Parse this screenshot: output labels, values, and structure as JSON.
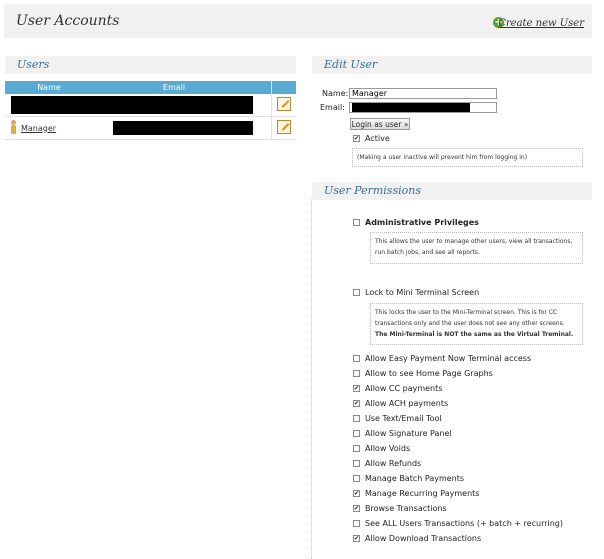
{
  "header": {
    "title": "User Accounts",
    "create_label": "Create new User"
  },
  "users": {
    "panel_title": "Users",
    "columns": [
      "Name",
      "Email"
    ],
    "rows": [
      {
        "name": "",
        "email": ""
      },
      {
        "name": "Manager",
        "email": ""
      }
    ]
  },
  "edit_user": {
    "panel_title": "Edit User",
    "name_label": "Name:",
    "name_value": "Manager",
    "email_label": "Email:",
    "login_button": "Login as user »",
    "active_label": "Active",
    "active_checked": true,
    "active_note": "(Making a user inactive will prevent him from logging in)"
  },
  "permissions": {
    "panel_title": "User Permissions",
    "admin": {
      "label": "Administrative Privileges",
      "checked": false,
      "note_1": "This allows the user to manage other users, view all transactions,",
      "note_2": "run batch jobs, and see all reports."
    },
    "lock": {
      "label": "Lock to Mini Terminal Screen",
      "checked": false,
      "note_1": "This locks the user to the Mini-Terminal screen. This is for CC",
      "note_2": "transactions only and the user does not see any other screens.",
      "note_3": "The Mini-Terminal is NOT the same as the Virtual Treminal."
    },
    "items": [
      {
        "label": "Allow Easy Payment Now Terminal access",
        "checked": false
      },
      {
        "label": "Allow to see Home Page Graphs",
        "checked": false
      },
      {
        "label": "Allow CC payments",
        "checked": true
      },
      {
        "label": "Allow ACH payments",
        "checked": true
      },
      {
        "label": "Use Text/Email Tool",
        "checked": false
      },
      {
        "label": "Allow Signature Panel",
        "checked": false
      },
      {
        "label": "Allow Voids",
        "checked": false
      },
      {
        "label": "Allow Refunds",
        "checked": false
      },
      {
        "label": "Manage Batch Payments",
        "checked": false
      },
      {
        "label": "Manage Recurring Payments",
        "checked": true
      },
      {
        "label": "Browse Transactions",
        "checked": true
      },
      {
        "label": "See ALL Users Transactions (+ batch + recurring)",
        "checked": false
      },
      {
        "label": "Allow Download Transactions",
        "checked": true
      }
    ]
  }
}
